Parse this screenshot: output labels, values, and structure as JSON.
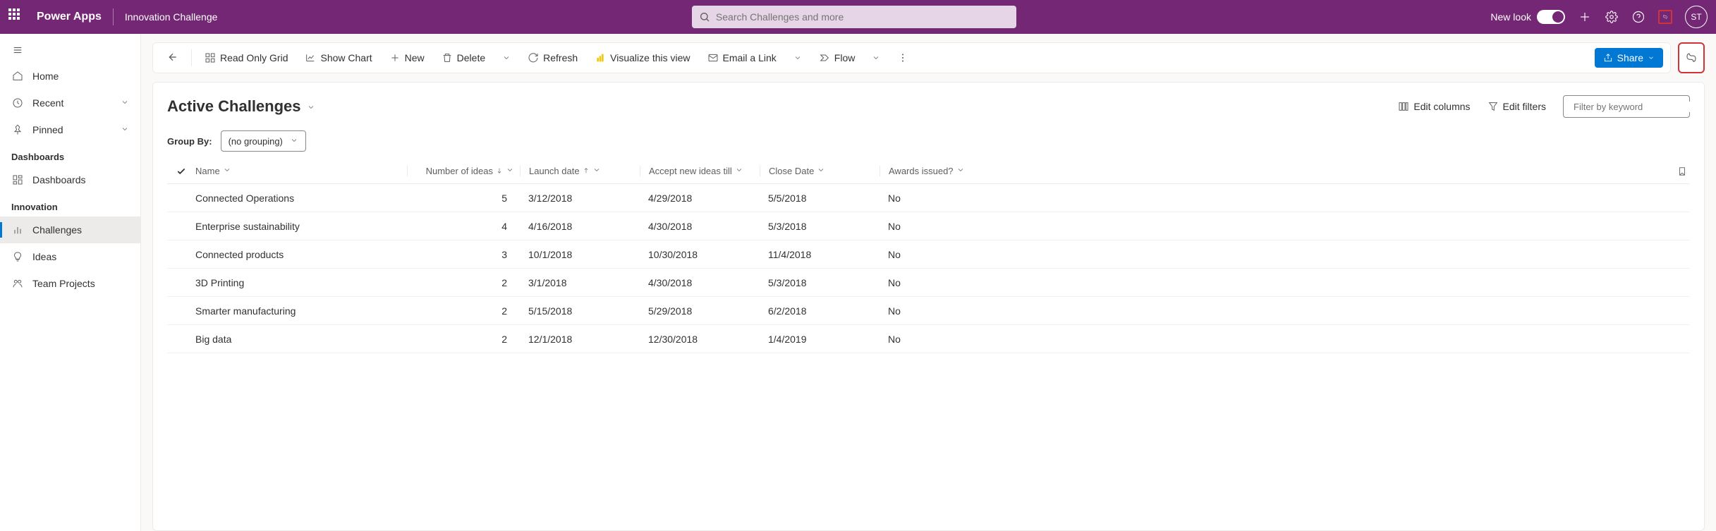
{
  "header": {
    "brand": "Power Apps",
    "app_name": "Innovation Challenge",
    "search_placeholder": "Search Challenges and more",
    "new_look": "New look",
    "avatar": "ST"
  },
  "sidebar": {
    "home": "Home",
    "recent": "Recent",
    "pinned": "Pinned",
    "section_dashboards": "Dashboards",
    "dashboards": "Dashboards",
    "section_innovation": "Innovation",
    "challenges": "Challenges",
    "ideas": "Ideas",
    "team_projects": "Team Projects"
  },
  "commandbar": {
    "read_only_grid": "Read Only Grid",
    "show_chart": "Show Chart",
    "new": "New",
    "delete": "Delete",
    "refresh": "Refresh",
    "visualize": "Visualize this view",
    "email_link": "Email a Link",
    "flow": "Flow",
    "share": "Share"
  },
  "view": {
    "title": "Active Challenges",
    "edit_columns": "Edit columns",
    "edit_filters": "Edit filters",
    "filter_placeholder": "Filter by keyword",
    "groupby_label": "Group By:",
    "groupby_value": "(no grouping)"
  },
  "columns": {
    "name": "Name",
    "ideas": "Number of ideas",
    "launch": "Launch date",
    "accept": "Accept new ideas till",
    "close": "Close Date",
    "awards": "Awards issued?"
  },
  "rows": [
    {
      "name": "Connected Operations",
      "ideas": "5",
      "launch": "3/12/2018",
      "accept": "4/29/2018",
      "close": "5/5/2018",
      "awards": "No"
    },
    {
      "name": "Enterprise sustainability",
      "ideas": "4",
      "launch": "4/16/2018",
      "accept": "4/30/2018",
      "close": "5/3/2018",
      "awards": "No"
    },
    {
      "name": "Connected products",
      "ideas": "3",
      "launch": "10/1/2018",
      "accept": "10/30/2018",
      "close": "11/4/2018",
      "awards": "No"
    },
    {
      "name": "3D Printing",
      "ideas": "2",
      "launch": "3/1/2018",
      "accept": "4/30/2018",
      "close": "5/3/2018",
      "awards": "No"
    },
    {
      "name": "Smarter manufacturing",
      "ideas": "2",
      "launch": "5/15/2018",
      "accept": "5/29/2018",
      "close": "6/2/2018",
      "awards": "No"
    },
    {
      "name": "Big data",
      "ideas": "2",
      "launch": "12/1/2018",
      "accept": "12/30/2018",
      "close": "1/4/2019",
      "awards": "No"
    }
  ]
}
